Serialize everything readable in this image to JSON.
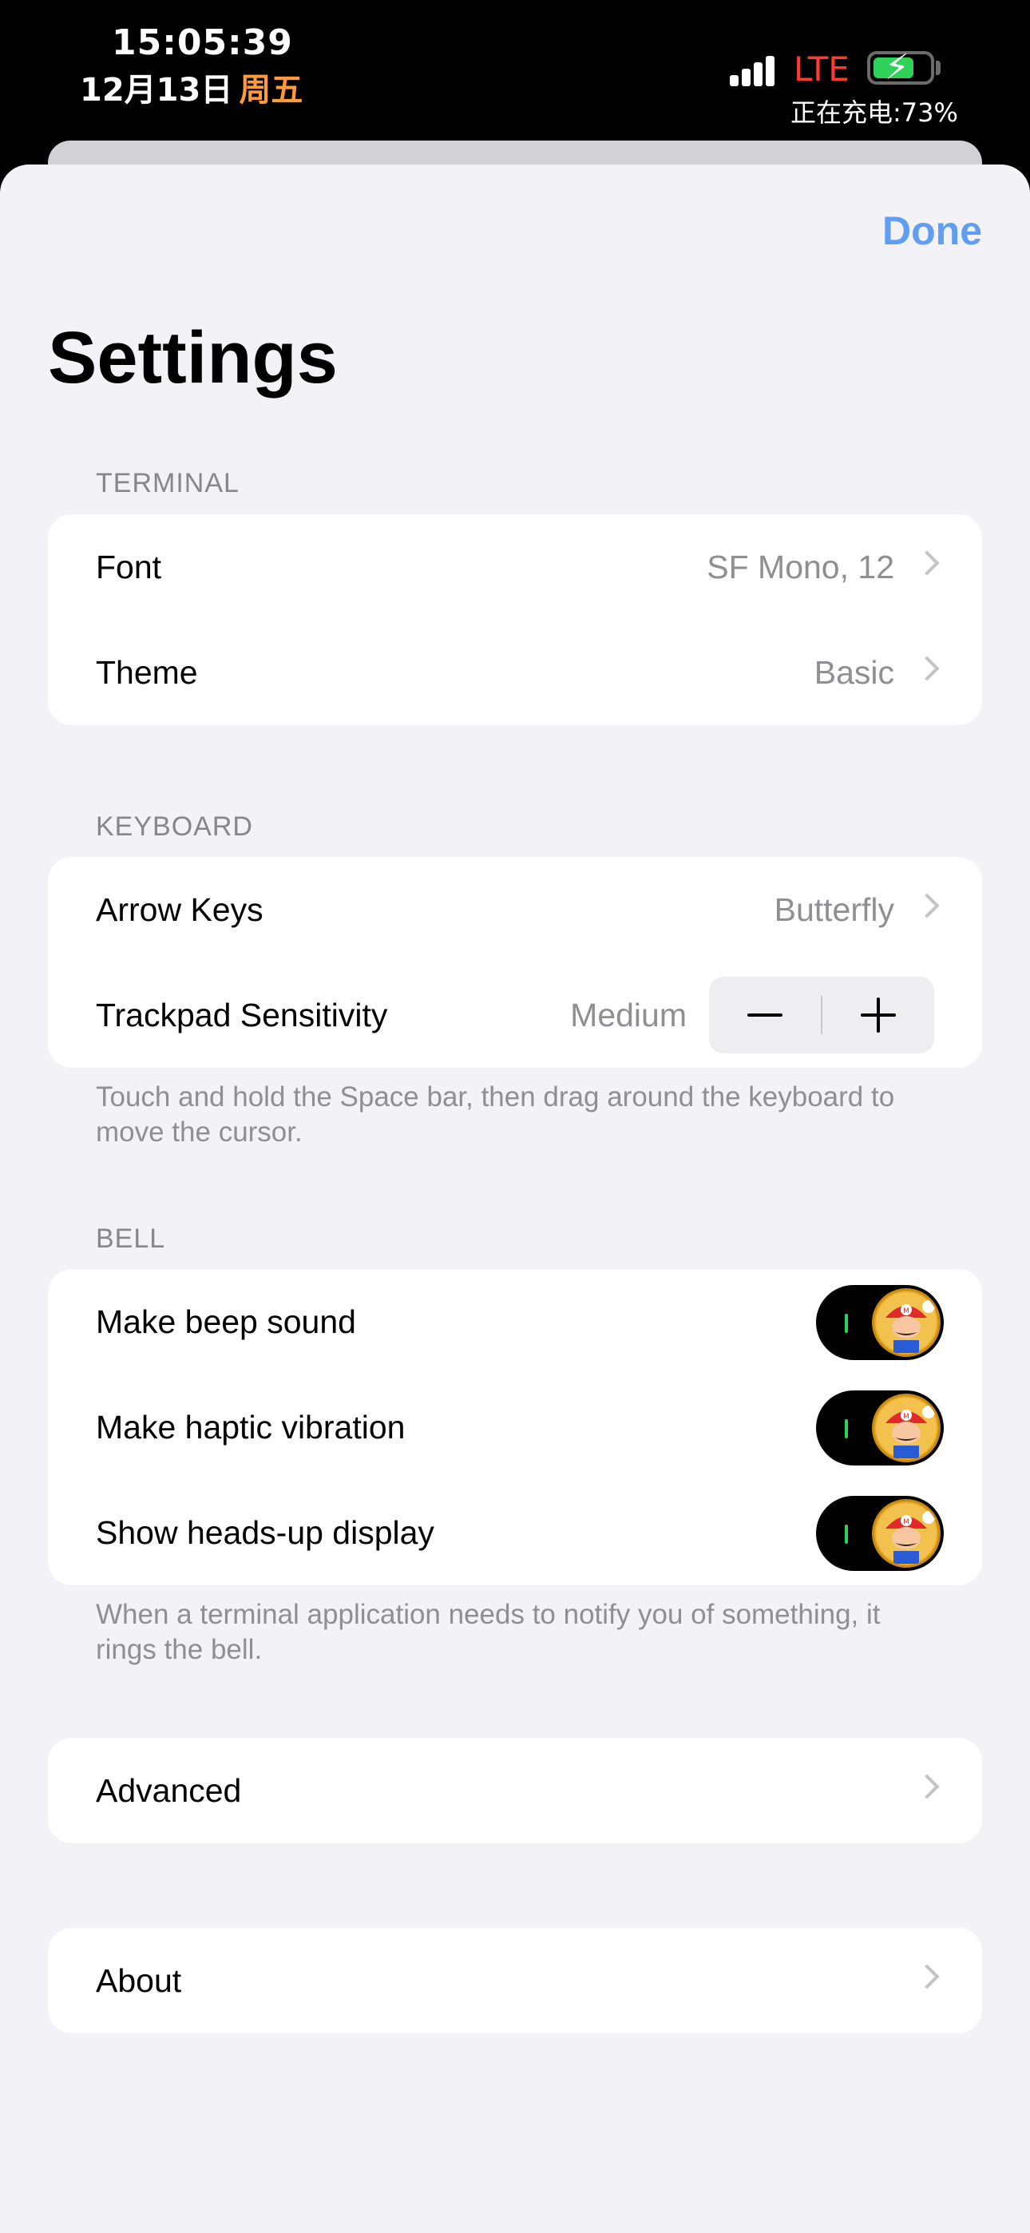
{
  "status_bar": {
    "time": "15:05:39",
    "date": "12月13日",
    "weekday": "周五",
    "network": "LTE",
    "charging_text": "正在充电:73%",
    "battery_percent": 73,
    "accent_colors": {
      "weekday": "#ff9a3c",
      "network": "#ff3b30",
      "battery": "#30d158"
    }
  },
  "header": {
    "done_label": "Done",
    "title": "Settings",
    "accent_color": "#5f9ef0"
  },
  "terminal": {
    "header": "TERMINAL",
    "rows": [
      {
        "label": "Font",
        "value": "SF Mono, 12",
        "icon": "chevron-right-icon"
      },
      {
        "label": "Theme",
        "value": "Basic",
        "icon": "chevron-right-icon"
      }
    ]
  },
  "keyboard": {
    "header": "KEYBOARD",
    "arrow_keys": {
      "label": "Arrow Keys",
      "value": "Butterfly",
      "icon": "chevron-right-icon"
    },
    "trackpad": {
      "label": "Trackpad Sensitivity",
      "value": "Medium",
      "icons": [
        "minus-icon",
        "plus-icon"
      ]
    },
    "footer": "Touch and hold the Space bar, then drag around the keyboard to move the cursor."
  },
  "bell": {
    "header": "BELL",
    "rows": [
      {
        "label": "Make beep sound",
        "on": true,
        "icon": "mario-toggle-knob"
      },
      {
        "label": "Make haptic vibration",
        "on": true,
        "icon": "mario-toggle-knob"
      },
      {
        "label": "Show heads-up display",
        "on": true,
        "icon": "mario-toggle-knob"
      }
    ],
    "footer": "When a terminal application needs to notify you of something, it rings the bell."
  },
  "advanced": {
    "label": "Advanced",
    "icon": "chevron-right-icon"
  },
  "about": {
    "label": "About",
    "icon": "chevron-right-icon"
  }
}
